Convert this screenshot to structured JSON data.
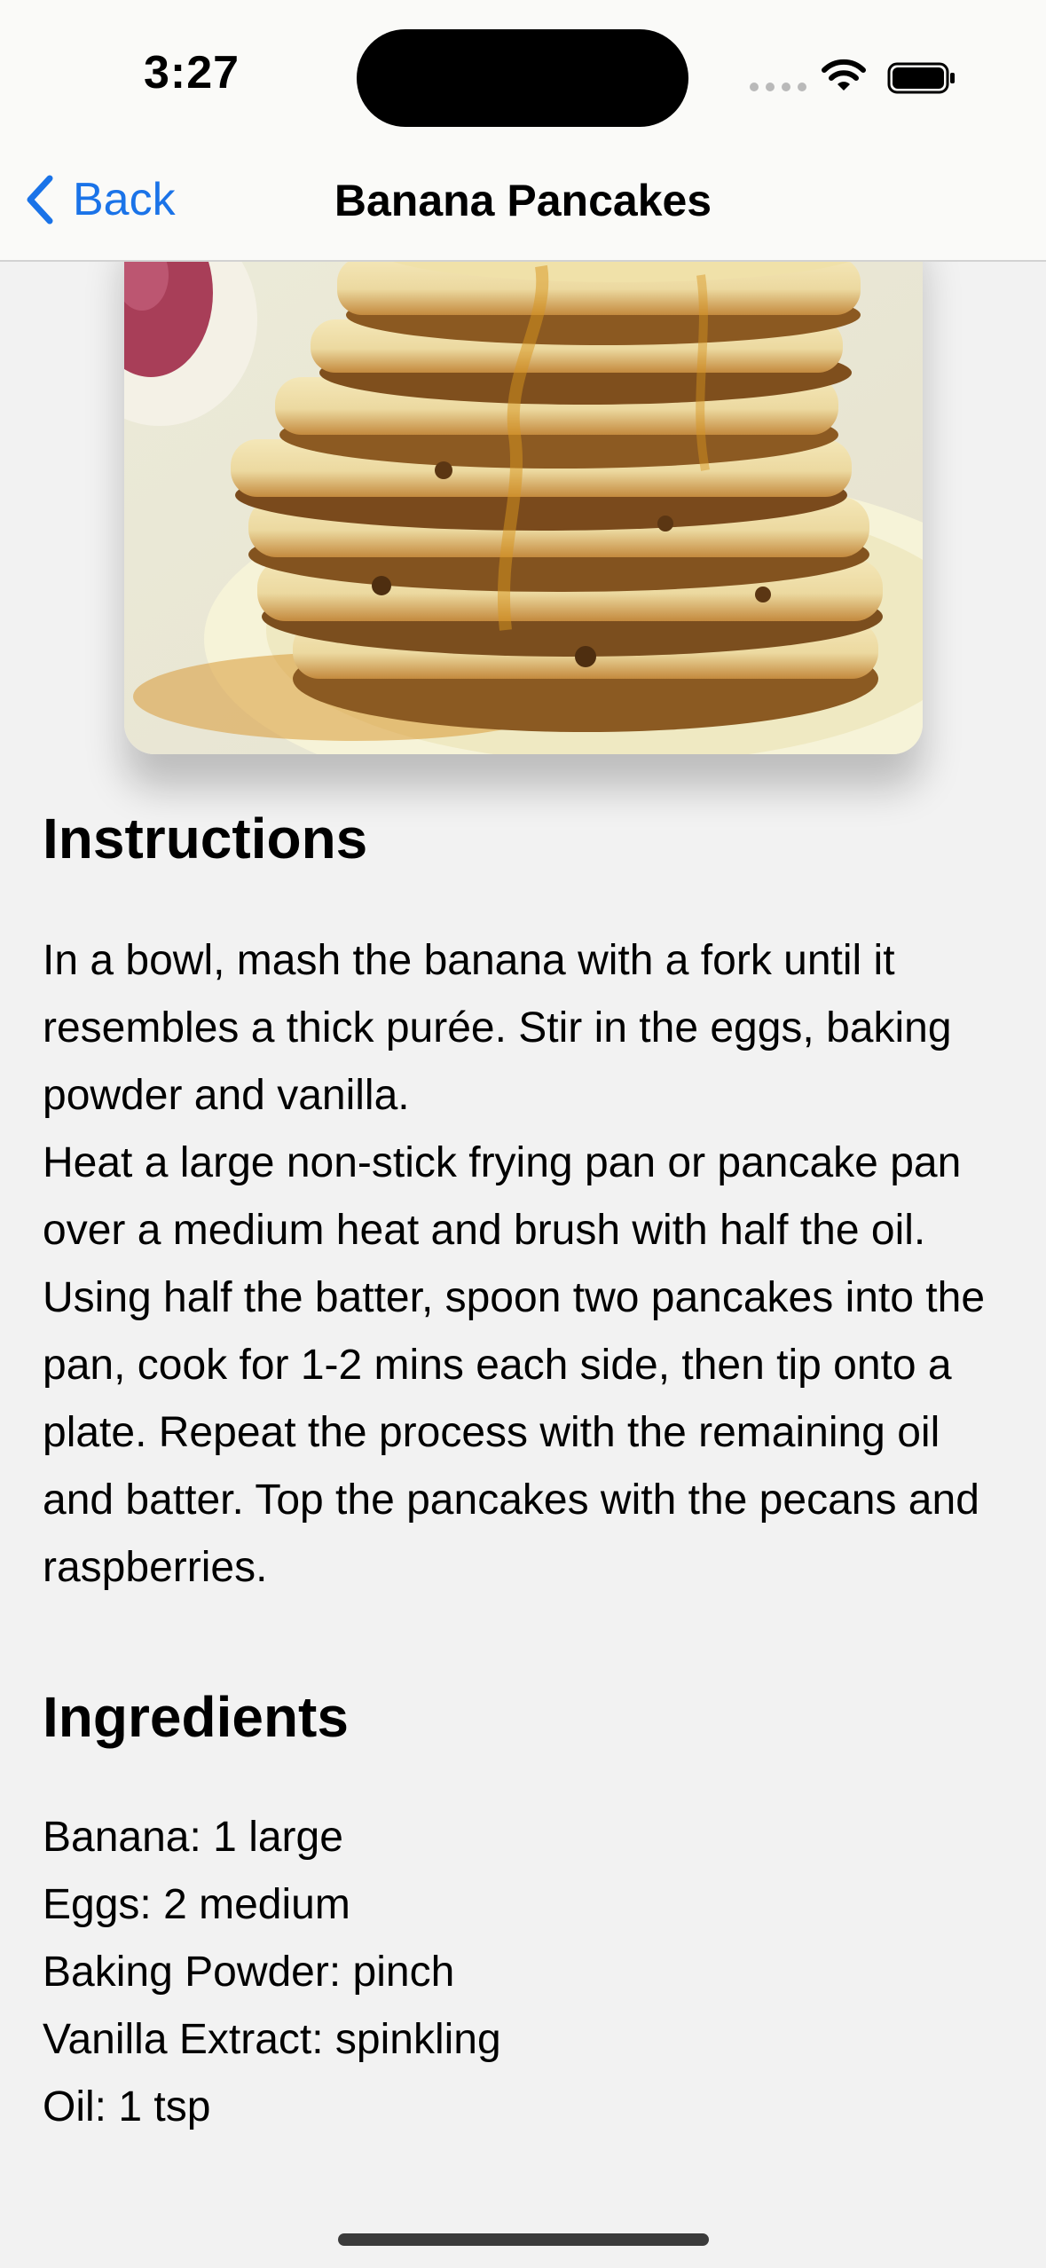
{
  "status_bar": {
    "time": "3:27"
  },
  "nav": {
    "back_label": "Back",
    "title": "Banana Pancakes"
  },
  "photo": {
    "subject": "stack-of-banana-pancakes"
  },
  "instructions": {
    "heading": "Instructions",
    "paragraphs": [
      "In a bowl, mash the banana with a fork until it resembles a thick purée. Stir in the eggs, baking powder and vanilla.",
      "Heat a large non-stick frying pan or pancake pan over a medium heat and brush with half the oil. Using half the batter, spoon two pancakes into the pan, cook for 1-2 mins each side, then tip onto a plate. Repeat the process with the remaining oil and batter. Top the pancakes with the pecans and raspberries."
    ]
  },
  "ingredients": {
    "heading": "Ingredients",
    "items": [
      "Banana: 1 large",
      "Eggs: 2 medium",
      "Baking Powder: pinch",
      "Vanilla Extract: spinkling",
      "Oil: 1 tsp"
    ]
  },
  "colors": {
    "accent": "#1a73e8",
    "background": "#f2f2f2",
    "nav_background": "#fafaf8"
  },
  "icons": {
    "back": "chevron-left-icon",
    "wifi": "wifi-icon",
    "battery": "battery-icon",
    "signal": "cellular-signal-icon"
  }
}
